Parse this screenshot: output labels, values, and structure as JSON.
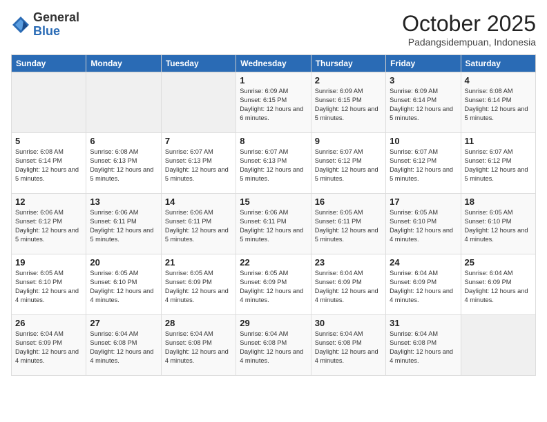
{
  "header": {
    "logo_general": "General",
    "logo_blue": "Blue",
    "month_title": "October 2025",
    "subtitle": "Padangsidempuan, Indonesia"
  },
  "days_of_week": [
    "Sunday",
    "Monday",
    "Tuesday",
    "Wednesday",
    "Thursday",
    "Friday",
    "Saturday"
  ],
  "weeks": [
    [
      {
        "day": "",
        "info": ""
      },
      {
        "day": "",
        "info": ""
      },
      {
        "day": "",
        "info": ""
      },
      {
        "day": "1",
        "info": "Sunrise: 6:09 AM\nSunset: 6:15 PM\nDaylight: 12 hours and 6 minutes."
      },
      {
        "day": "2",
        "info": "Sunrise: 6:09 AM\nSunset: 6:15 PM\nDaylight: 12 hours and 5 minutes."
      },
      {
        "day": "3",
        "info": "Sunrise: 6:09 AM\nSunset: 6:14 PM\nDaylight: 12 hours and 5 minutes."
      },
      {
        "day": "4",
        "info": "Sunrise: 6:08 AM\nSunset: 6:14 PM\nDaylight: 12 hours and 5 minutes."
      }
    ],
    [
      {
        "day": "5",
        "info": "Sunrise: 6:08 AM\nSunset: 6:14 PM\nDaylight: 12 hours and 5 minutes."
      },
      {
        "day": "6",
        "info": "Sunrise: 6:08 AM\nSunset: 6:13 PM\nDaylight: 12 hours and 5 minutes."
      },
      {
        "day": "7",
        "info": "Sunrise: 6:07 AM\nSunset: 6:13 PM\nDaylight: 12 hours and 5 minutes."
      },
      {
        "day": "8",
        "info": "Sunrise: 6:07 AM\nSunset: 6:13 PM\nDaylight: 12 hours and 5 minutes."
      },
      {
        "day": "9",
        "info": "Sunrise: 6:07 AM\nSunset: 6:12 PM\nDaylight: 12 hours and 5 minutes."
      },
      {
        "day": "10",
        "info": "Sunrise: 6:07 AM\nSunset: 6:12 PM\nDaylight: 12 hours and 5 minutes."
      },
      {
        "day": "11",
        "info": "Sunrise: 6:07 AM\nSunset: 6:12 PM\nDaylight: 12 hours and 5 minutes."
      }
    ],
    [
      {
        "day": "12",
        "info": "Sunrise: 6:06 AM\nSunset: 6:12 PM\nDaylight: 12 hours and 5 minutes."
      },
      {
        "day": "13",
        "info": "Sunrise: 6:06 AM\nSunset: 6:11 PM\nDaylight: 12 hours and 5 minutes."
      },
      {
        "day": "14",
        "info": "Sunrise: 6:06 AM\nSunset: 6:11 PM\nDaylight: 12 hours and 5 minutes."
      },
      {
        "day": "15",
        "info": "Sunrise: 6:06 AM\nSunset: 6:11 PM\nDaylight: 12 hours and 5 minutes."
      },
      {
        "day": "16",
        "info": "Sunrise: 6:05 AM\nSunset: 6:11 PM\nDaylight: 12 hours and 5 minutes."
      },
      {
        "day": "17",
        "info": "Sunrise: 6:05 AM\nSunset: 6:10 PM\nDaylight: 12 hours and 4 minutes."
      },
      {
        "day": "18",
        "info": "Sunrise: 6:05 AM\nSunset: 6:10 PM\nDaylight: 12 hours and 4 minutes."
      }
    ],
    [
      {
        "day": "19",
        "info": "Sunrise: 6:05 AM\nSunset: 6:10 PM\nDaylight: 12 hours and 4 minutes."
      },
      {
        "day": "20",
        "info": "Sunrise: 6:05 AM\nSunset: 6:10 PM\nDaylight: 12 hours and 4 minutes."
      },
      {
        "day": "21",
        "info": "Sunrise: 6:05 AM\nSunset: 6:09 PM\nDaylight: 12 hours and 4 minutes."
      },
      {
        "day": "22",
        "info": "Sunrise: 6:05 AM\nSunset: 6:09 PM\nDaylight: 12 hours and 4 minutes."
      },
      {
        "day": "23",
        "info": "Sunrise: 6:04 AM\nSunset: 6:09 PM\nDaylight: 12 hours and 4 minutes."
      },
      {
        "day": "24",
        "info": "Sunrise: 6:04 AM\nSunset: 6:09 PM\nDaylight: 12 hours and 4 minutes."
      },
      {
        "day": "25",
        "info": "Sunrise: 6:04 AM\nSunset: 6:09 PM\nDaylight: 12 hours and 4 minutes."
      }
    ],
    [
      {
        "day": "26",
        "info": "Sunrise: 6:04 AM\nSunset: 6:09 PM\nDaylight: 12 hours and 4 minutes."
      },
      {
        "day": "27",
        "info": "Sunrise: 6:04 AM\nSunset: 6:08 PM\nDaylight: 12 hours and 4 minutes."
      },
      {
        "day": "28",
        "info": "Sunrise: 6:04 AM\nSunset: 6:08 PM\nDaylight: 12 hours and 4 minutes."
      },
      {
        "day": "29",
        "info": "Sunrise: 6:04 AM\nSunset: 6:08 PM\nDaylight: 12 hours and 4 minutes."
      },
      {
        "day": "30",
        "info": "Sunrise: 6:04 AM\nSunset: 6:08 PM\nDaylight: 12 hours and 4 minutes."
      },
      {
        "day": "31",
        "info": "Sunrise: 6:04 AM\nSunset: 6:08 PM\nDaylight: 12 hours and 4 minutes."
      },
      {
        "day": "",
        "info": ""
      }
    ]
  ]
}
